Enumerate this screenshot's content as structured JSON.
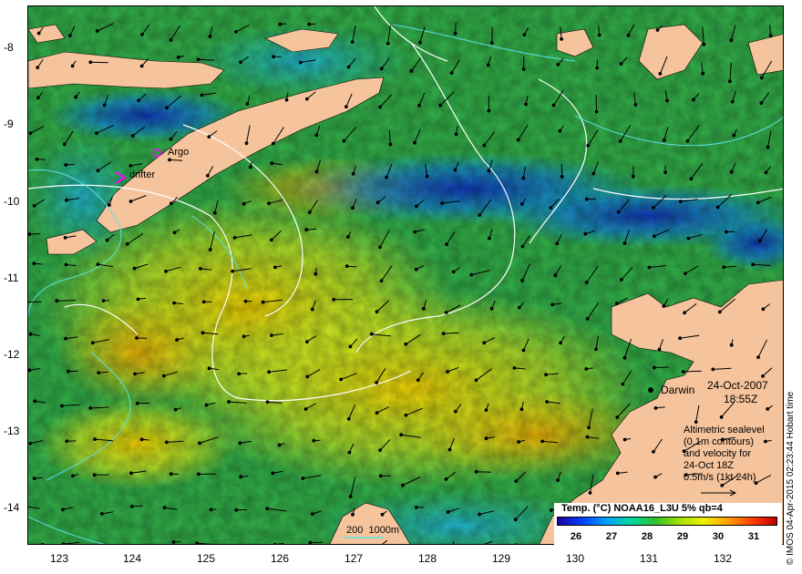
{
  "axes": {
    "y_ticks": [
      "-8",
      "-9",
      "-10",
      "-11",
      "-12",
      "-13",
      "-14"
    ],
    "x_ticks": [
      "123",
      "124",
      "125",
      "126",
      "127",
      "128",
      "129",
      "130",
      "131",
      "132"
    ],
    "lon_range": [
      122.6,
      132.7
    ],
    "lat_range": [
      -7.6,
      -14.5
    ]
  },
  "labels": {
    "argo": "Argo",
    "drifter": "drifter",
    "darwin": "Darwin",
    "date": "24-Oct-2007",
    "time": "18:55Z",
    "legend_line1": "Altimetric sealevel",
    "legend_line2": "(0.1m contours)",
    "legend_line3": "and velocity for",
    "legend_line4": "24-Oct 18Z",
    "legend_line5": "0.5m/s (1kt 24h)",
    "depth_key": "200  1000m",
    "credit": "© IMOS 04-Apr-2015 02:23:44 Hobart time"
  },
  "colorbar": {
    "title": "Temp. (°C) NOAA16_L3U 5% qb=4",
    "ticks": [
      "26",
      "27",
      "28",
      "29",
      "30",
      "31"
    ],
    "range": [
      25.5,
      31.7
    ],
    "colors": [
      "#1a00a0",
      "#0040ff",
      "#00a0ff",
      "#00d8a0",
      "#30c030",
      "#a0e000",
      "#f0f000",
      "#ffa000",
      "#ff4000",
      "#c00000"
    ]
  },
  "colors": {
    "land": "#f5c49c",
    "sst_base": "#33b14a",
    "contour": "#ffffff",
    "depth_contour": "#5ee0e6",
    "marker": "#ff00ff"
  }
}
